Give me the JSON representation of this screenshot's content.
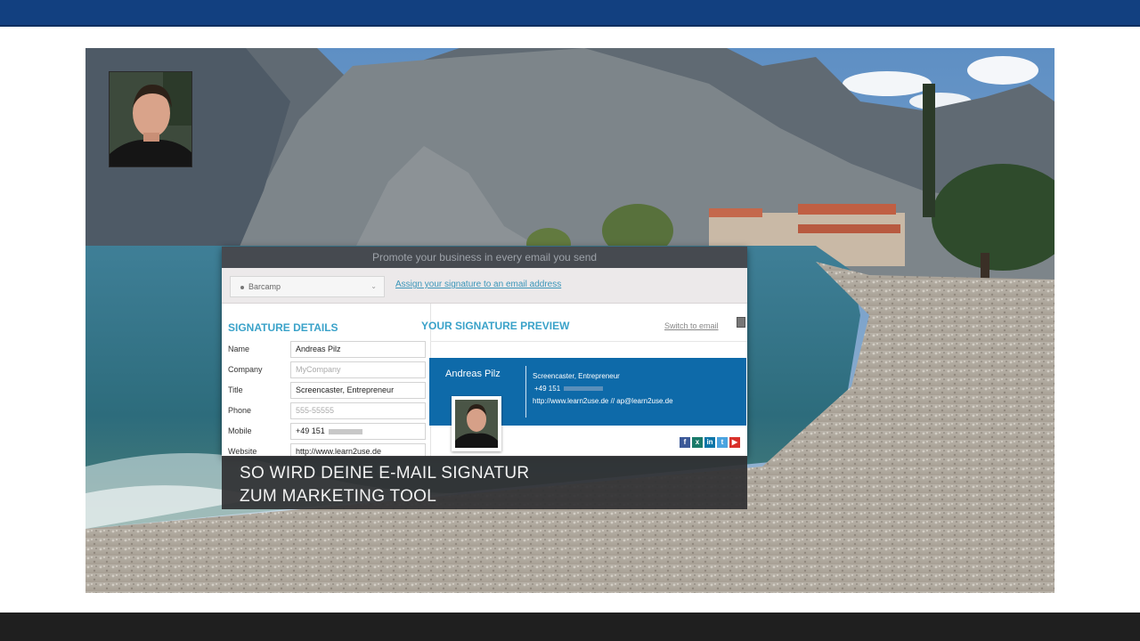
{
  "colors": {
    "top_bar": "#124080",
    "bottom_bar": "#1f1f1f",
    "accent": "#3aa2c9",
    "signature_card": "#0e6aa9",
    "caption_bg": "#303032"
  },
  "app": {
    "header_text": "Promote your business in every email you send",
    "toolbar": {
      "signature_select_value": "Barcamp",
      "assign_link": "Assign your signature to an email address"
    },
    "details": {
      "title": "SIGNATURE DETAILS",
      "fields": [
        {
          "label": "Name",
          "value": "Andreas Pilz",
          "placeholder": ""
        },
        {
          "label": "Company",
          "value": "",
          "placeholder": "MyCompany"
        },
        {
          "label": "Title",
          "value": "Screencaster, Entrepreneur",
          "placeholder": ""
        },
        {
          "label": "Phone",
          "value": "",
          "placeholder": "555-55555"
        },
        {
          "label": "Mobile",
          "value": "+49 151",
          "placeholder": ""
        },
        {
          "label": "Website",
          "value": "http://www.learn2use.de",
          "placeholder": ""
        }
      ]
    },
    "preview": {
      "title": "YOUR SIGNATURE PREVIEW",
      "switch_link": "Switch to email",
      "name": "Andreas Pilz",
      "job_title": "Screencaster, Entrepreneur",
      "phone": "+49 151",
      "web_line": "http://www.learn2use.de // ap@learn2use.de",
      "social_icons": [
        "facebook-icon",
        "xing-icon",
        "linkedin-icon",
        "twitter-icon",
        "youtube-icon"
      ]
    }
  },
  "caption": {
    "line1": "SO WIRD DEINE E-MAIL SIGNATUR",
    "line2": "ZUM MARKETING TOOL"
  }
}
